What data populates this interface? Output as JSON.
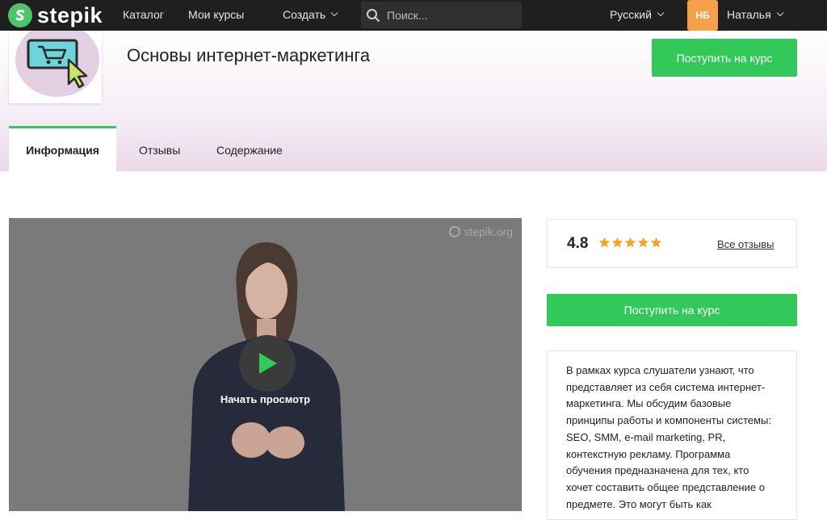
{
  "navbar": {
    "logo_text": "stepik",
    "catalog": "Каталог",
    "my_courses": "Мои курсы",
    "create": "Создать",
    "search_placeholder": "Поиск...",
    "language": "Русский",
    "avatar_initials": "НБ",
    "user_name": "Наталья"
  },
  "course": {
    "title": "Основы интернет-маркетинга",
    "enroll_label": "Поступить на курс"
  },
  "tabs": [
    {
      "label": "Информация",
      "active": true
    },
    {
      "label": "Отзывы",
      "active": false
    },
    {
      "label": "Содержание",
      "active": false
    }
  ],
  "video": {
    "watermark": "stepik.org",
    "play_label": "Начать просмотр"
  },
  "rating": {
    "value": "4.8",
    "stars": 5,
    "all_reviews": "Все отзывы"
  },
  "sidebar": {
    "enroll_label": "Поступить на курс",
    "description": "В рамках курса слушатели узнают, что представляет из себя система интернет-маркетинга. Мы обсудим базовые принципы работы и компоненты системы: SEO, SMM, e-mail marketing, PR, контекстную рекламу. Программа обучения предназначена для тех, кто хочет составить общее представление о предмете. Это могут быть как"
  },
  "colors": {
    "navbar_bg": "#1f1f1f",
    "accent_green": "#32c95a",
    "star_orange": "#f5a623",
    "avatar_orange": "#f4a14a"
  }
}
